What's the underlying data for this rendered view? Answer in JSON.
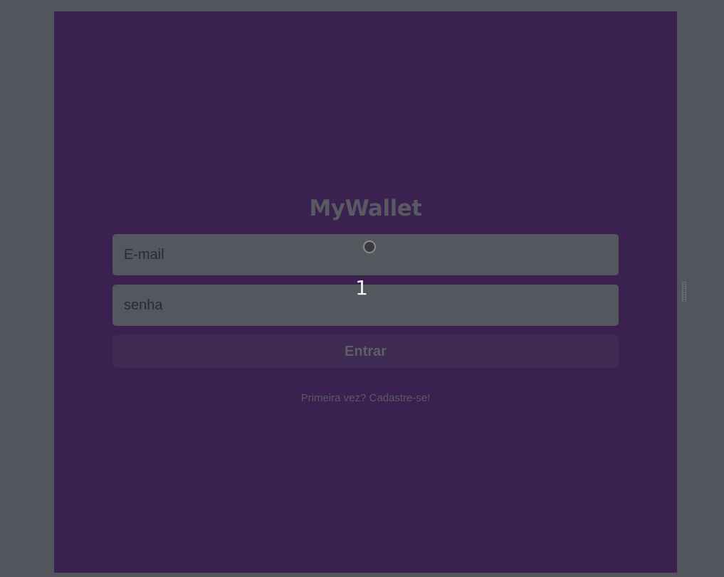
{
  "app": {
    "title": "MyWallet"
  },
  "login_form": {
    "email_placeholder": "E-mail",
    "password_placeholder": "senha",
    "submit_label": "Entrar",
    "signup_link": "Primeira vez? Cadastre-se!"
  },
  "overlay": {
    "step_number": "1"
  },
  "colors": {
    "background": "#52555c",
    "app_background": "#3a2150",
    "field_background": "#55575e",
    "button_background": "#3f2a52"
  }
}
